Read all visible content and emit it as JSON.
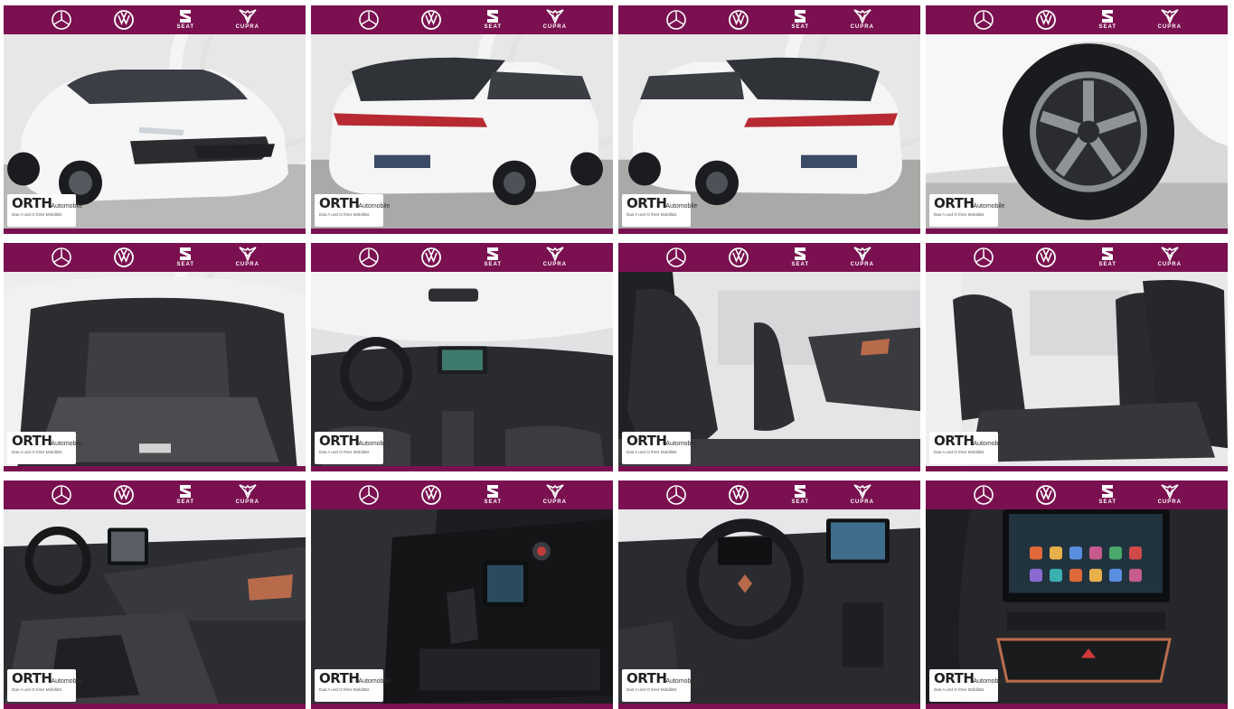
{
  "gallery": {
    "brands": [
      {
        "name": "Mercedes-Benz",
        "icon": "mercedes-star-icon",
        "label": ""
      },
      {
        "name": "Volkswagen",
        "icon": "vw-logo-icon",
        "label": ""
      },
      {
        "name": "SEAT",
        "icon": "seat-logo-icon",
        "label": "SEAT"
      },
      {
        "name": "CUPRA",
        "icon": "cupra-logo-icon",
        "label": "CUPRA"
      }
    ],
    "dealer_badge": {
      "name": "ORTH",
      "subtitle": "Automobile",
      "tagline": "Das A und O Ihrer Mobilität"
    },
    "colors": {
      "brand_bar": "#7a1050",
      "car_white": "#f4f4f4",
      "interior_dark": "#2a2b2d",
      "copper_accent": "#b86b4b"
    },
    "photos": [
      {
        "subject": "exterior-front-three-quarter"
      },
      {
        "subject": "exterior-rear-three-quarter-left"
      },
      {
        "subject": "exterior-rear-three-quarter-right"
      },
      {
        "subject": "wheel-close-up"
      },
      {
        "subject": "trunk-cargo-area"
      },
      {
        "subject": "dashboard-overview"
      },
      {
        "subject": "front-seats"
      },
      {
        "subject": "rear-seats"
      },
      {
        "subject": "dashboard-side-view"
      },
      {
        "subject": "center-console-gear-selector"
      },
      {
        "subject": "driver-cockpit"
      },
      {
        "subject": "infotainment-screen"
      }
    ]
  }
}
